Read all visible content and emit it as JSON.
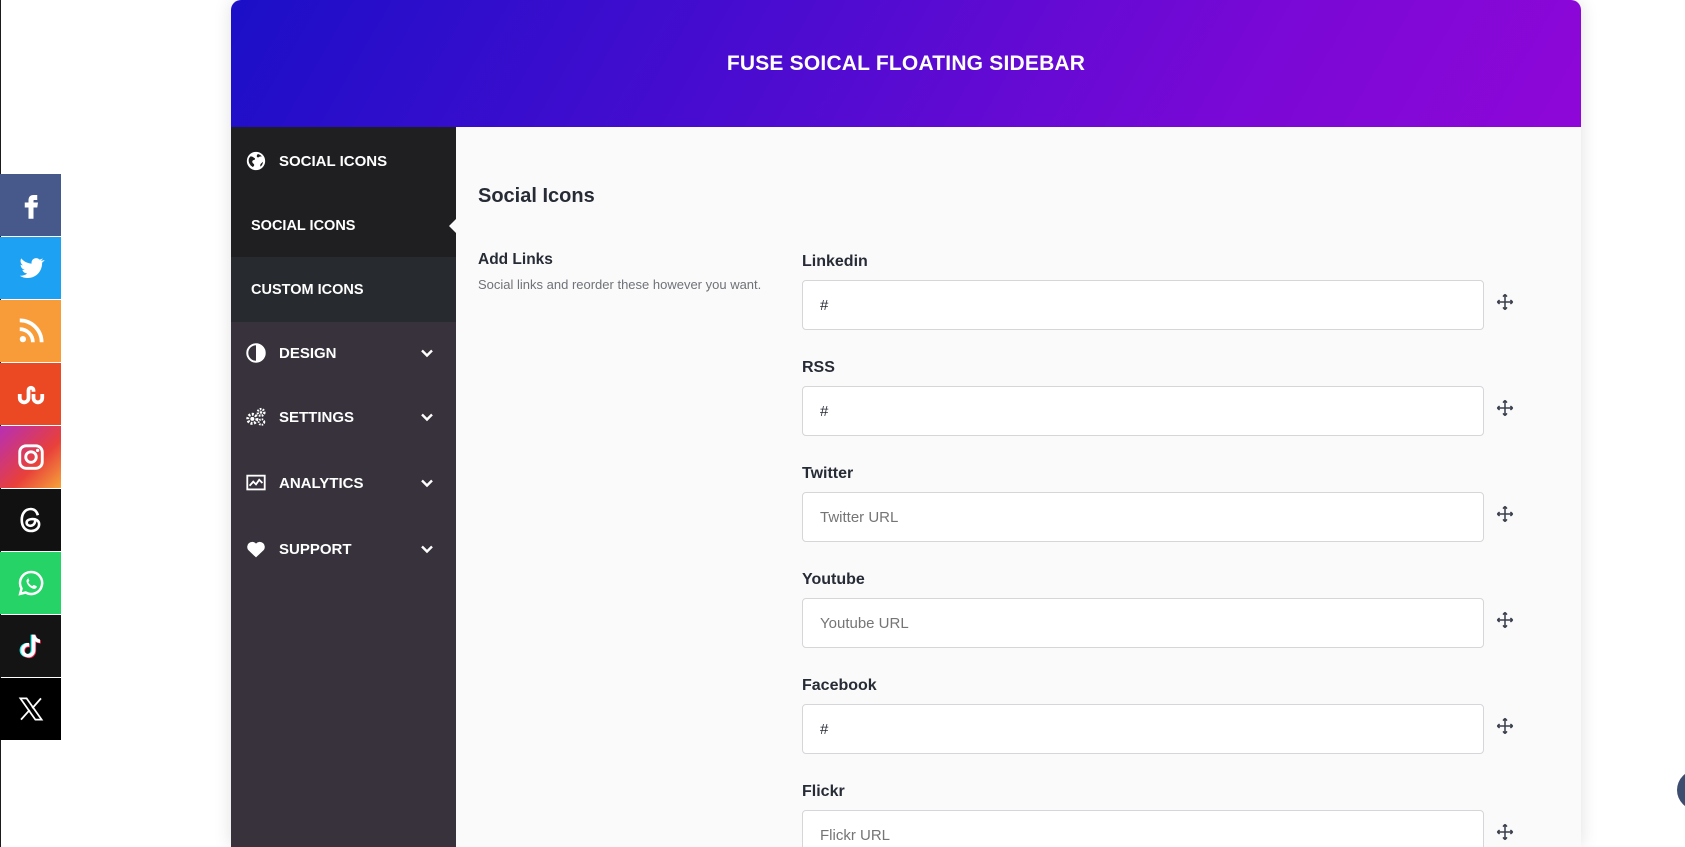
{
  "floating_sidebar": {
    "items": [
      {
        "name": "facebook",
        "color": "#3b5998",
        "icon": "facebook-icon"
      },
      {
        "name": "twitter",
        "color": "#1da1f2",
        "icon": "twitter-icon"
      },
      {
        "name": "rss",
        "color": "#f79c38",
        "icon": "rss-icon"
      },
      {
        "name": "stumbleupon",
        "color": "#eb4924",
        "icon": "stumbleupon-icon"
      },
      {
        "name": "instagram",
        "color": "#e4405f",
        "icon": "instagram-icon"
      },
      {
        "name": "threads",
        "color": "#000000",
        "icon": "threads-icon"
      },
      {
        "name": "whatsapp",
        "color": "#25d366",
        "icon": "whatsapp-icon"
      },
      {
        "name": "tiktok",
        "color": "#111111",
        "icon": "tiktok-icon"
      },
      {
        "name": "x",
        "color": "#000000",
        "icon": "x-icon"
      }
    ]
  },
  "header": {
    "title": "FUSE SOICAL FLOATING SIDEBAR"
  },
  "nav": {
    "top": {
      "label": "SOCIAL ICONS",
      "icon": "globe-icon"
    },
    "sub_items": [
      {
        "label": "SOCIAL ICONS",
        "active": true
      },
      {
        "label": "CUSTOM ICONS",
        "active": false
      }
    ],
    "items": [
      {
        "label": "DESIGN",
        "icon": "contrast-icon"
      },
      {
        "label": "SETTINGS",
        "icon": "gears-icon"
      },
      {
        "label": "ANALYTICS",
        "icon": "chart-icon"
      },
      {
        "label": "SUPPORT",
        "icon": "heart-icon"
      }
    ]
  },
  "main": {
    "section_title": "Social Icons",
    "desc_title": "Add Links",
    "desc_text": "Social links and reorder these however you want.",
    "fields": [
      {
        "label": "Linkedin",
        "value": "#",
        "placeholder": ""
      },
      {
        "label": "RSS",
        "value": "#",
        "placeholder": ""
      },
      {
        "label": "Twitter",
        "value": "",
        "placeholder": "Twitter URL"
      },
      {
        "label": "Youtube",
        "value": "",
        "placeholder": "Youtube URL"
      },
      {
        "label": "Facebook",
        "value": "#",
        "placeholder": ""
      },
      {
        "label": "Flickr",
        "value": "",
        "placeholder": "Flickr URL"
      }
    ]
  },
  "colors": {
    "nav_bg": "#37323c",
    "nav_dark": "#1f1f21",
    "header_gradient_start": "#1b0fc8",
    "header_gradient_end": "#8e07d8"
  }
}
